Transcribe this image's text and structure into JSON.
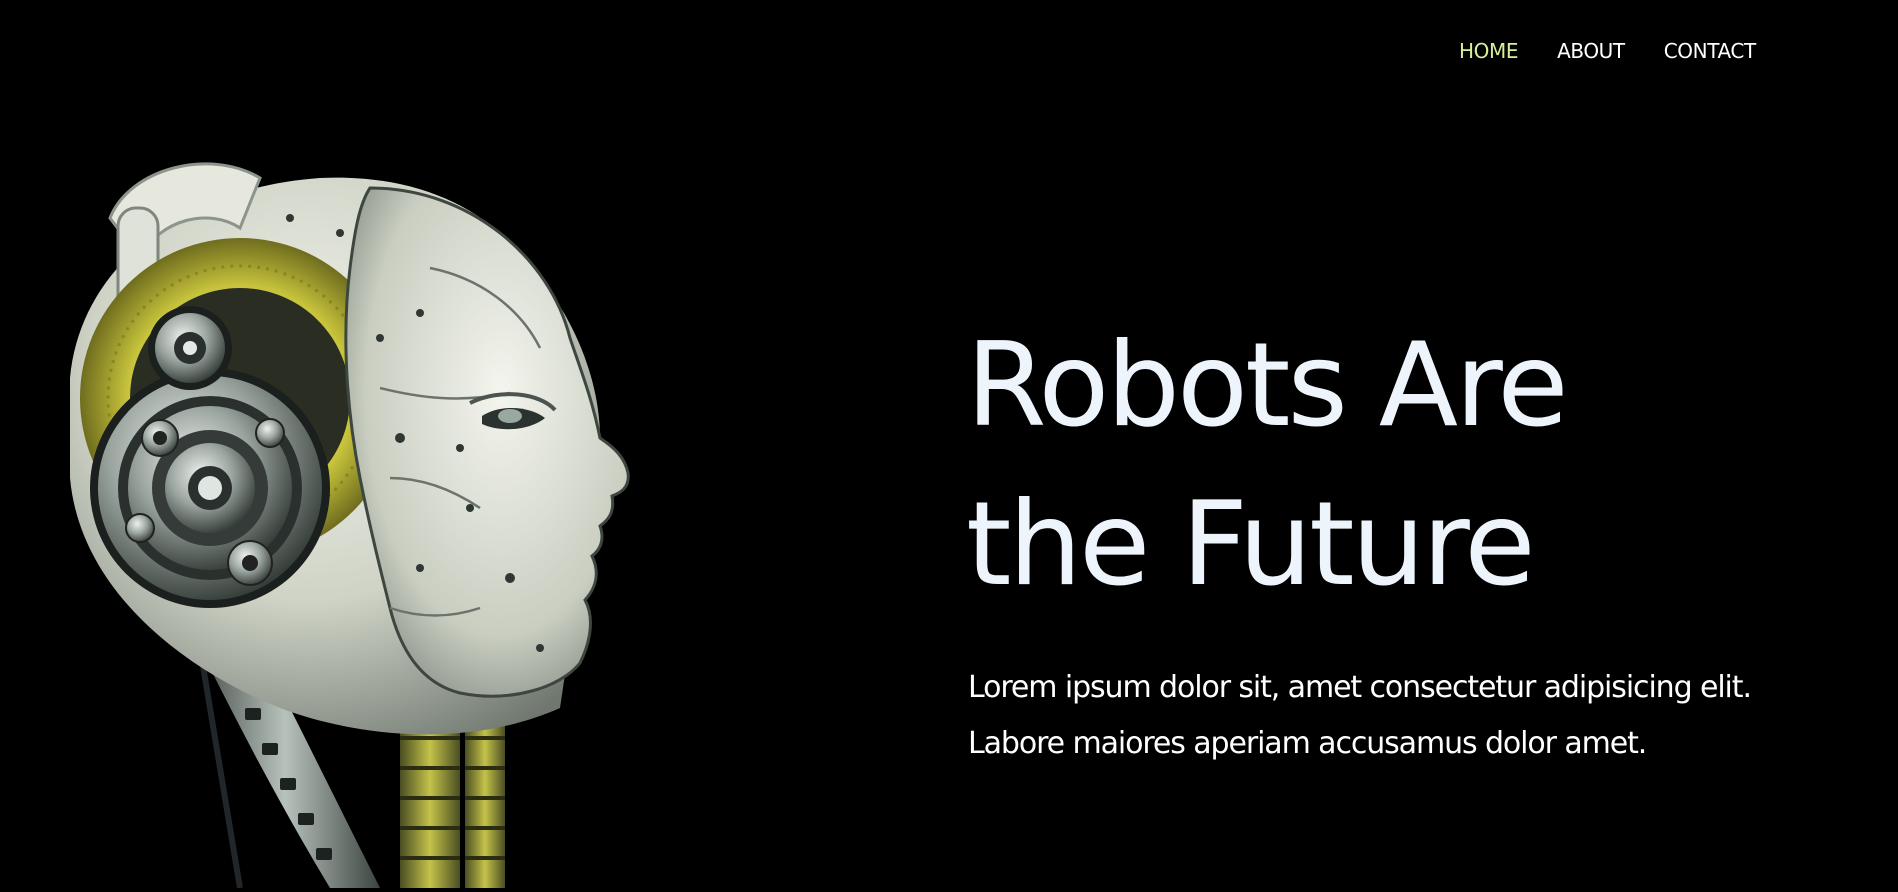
{
  "nav": {
    "items": [
      {
        "label": "HOME",
        "active": true
      },
      {
        "label": "ABOUT",
        "active": false
      },
      {
        "label": "CONTACT",
        "active": false
      }
    ],
    "active_color": "#d6ef9a",
    "text_color": "#ffffff"
  },
  "hero": {
    "title_line1": "Robots Are",
    "title_line2": "the Future",
    "body_line1": "Lorem ipsum dolor sit, amet consectetur adipisicing elit.",
    "body_line2": "Labore maiores aperiam accusamus dolor amet.",
    "image_icon": "robot-head-illustration"
  },
  "colors": {
    "background": "#000000",
    "title": "#eef4fb",
    "accent_yellow": "#c8c43c"
  }
}
